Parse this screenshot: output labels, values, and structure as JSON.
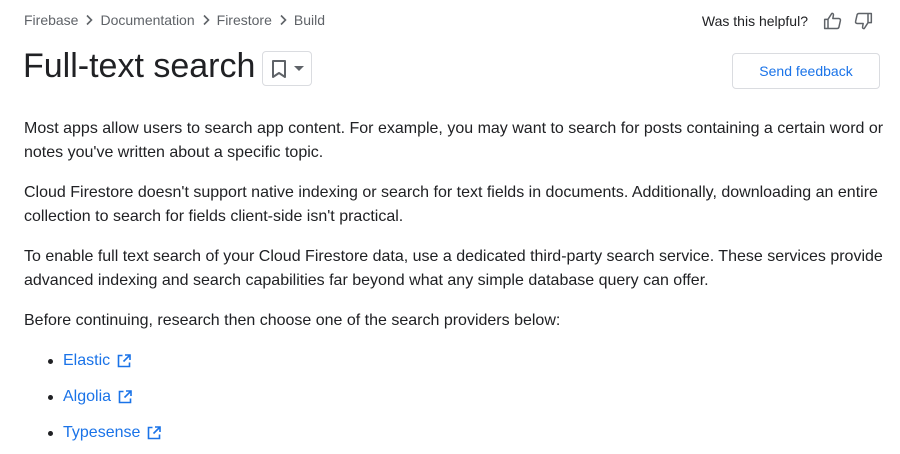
{
  "breadcrumb": {
    "items": [
      "Firebase",
      "Documentation",
      "Firestore",
      "Build"
    ],
    "separator_icon": "chevron-right-icon"
  },
  "helpful": {
    "label": "Was this helpful?",
    "thumb_up_icon": "thumb-up-icon",
    "thumb_down_icon": "thumb-down-icon"
  },
  "header": {
    "title": "Full-text search",
    "bookmark_icon": "bookmark-icon",
    "dropdown_icon": "caret-down-icon",
    "feedback_label": "Send feedback"
  },
  "content": {
    "paragraphs": [
      "Most apps allow users to search app content. For example, you may want to search for posts containing a certain word or notes you've written about a specific topic.",
      "Cloud Firestore doesn't support native indexing or search for text fields in documents. Additionally, downloading an entire collection to search for fields client-side isn't practical.",
      "To enable full text search of your Cloud Firestore data, use a dedicated third-party search service. These services provide advanced indexing and search capabilities far beyond what any simple database query can offer.",
      "Before continuing, research then choose one of the search providers below:"
    ],
    "providers": [
      {
        "label": "Elastic",
        "icon": "external-link-icon"
      },
      {
        "label": "Algolia",
        "icon": "external-link-icon"
      },
      {
        "label": "Typesense",
        "icon": "external-link-icon"
      }
    ]
  },
  "colors": {
    "link": "#1a73e8",
    "text": "#202124",
    "muted": "#5f6368",
    "border": "#dadce0"
  }
}
